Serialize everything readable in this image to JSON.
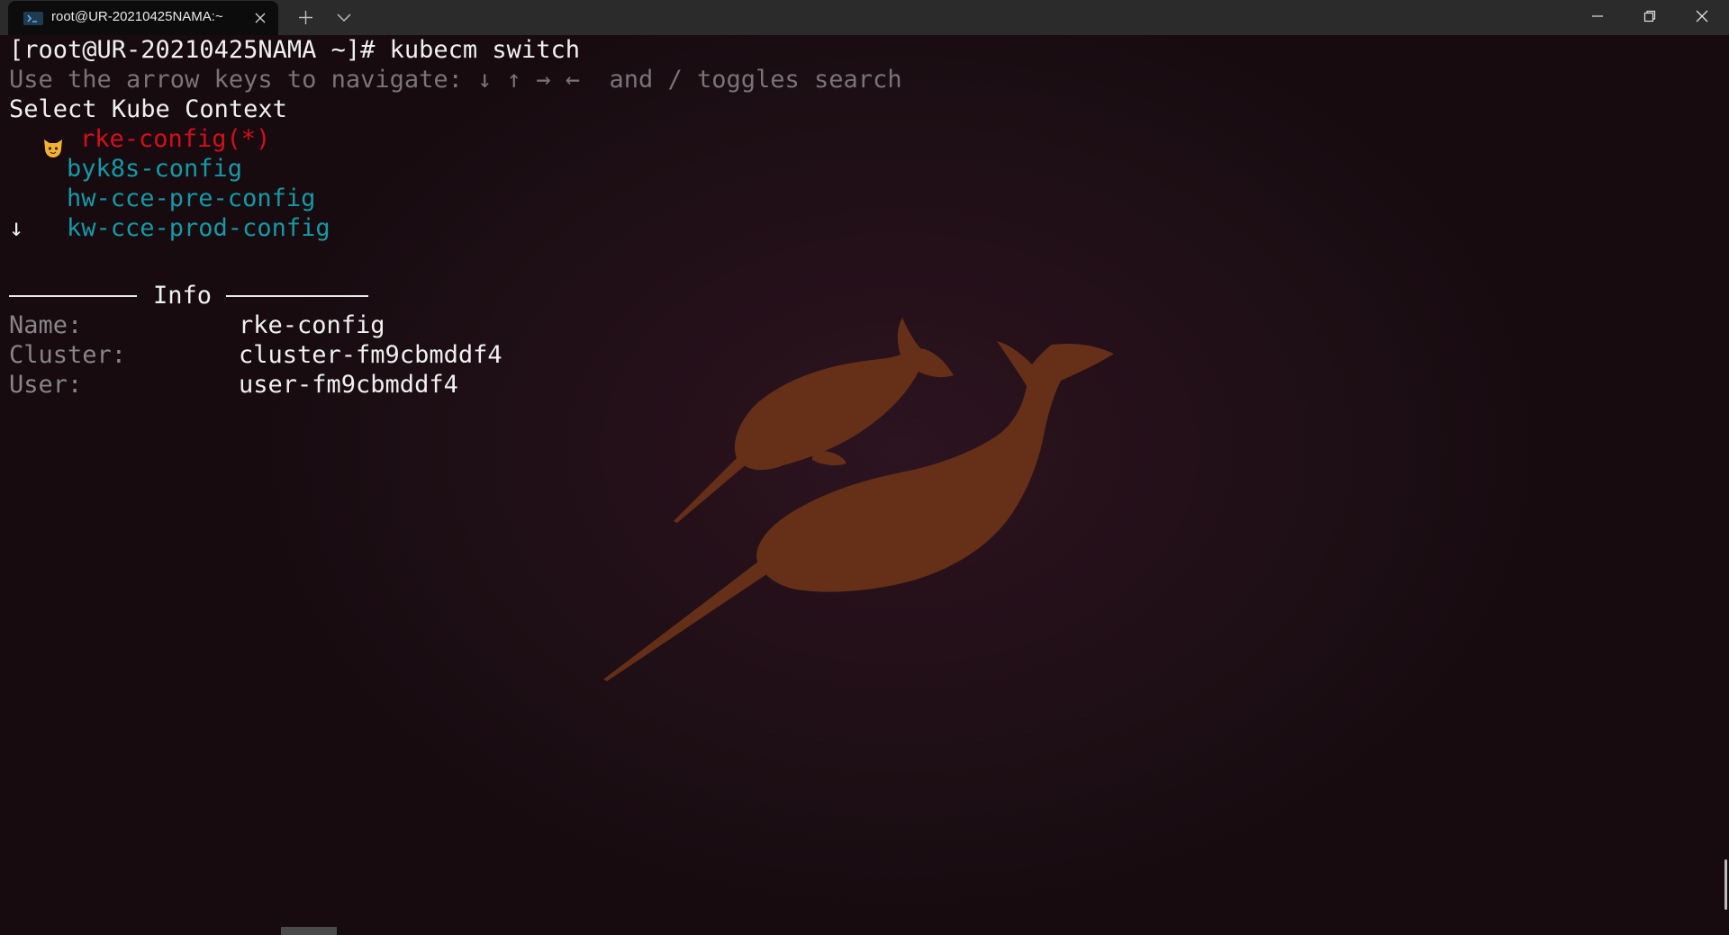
{
  "window": {
    "tab_title": "root@UR-20210425NAMA:~",
    "colors": {
      "titlebar": "#2b2b2b",
      "tab": "#0c0c0c",
      "terminal_bg": "#1e0f16",
      "narwhal": "#6b3218",
      "selected_item": "#d20f1b",
      "item": "#139aa6"
    }
  },
  "icons": {
    "tab_icon": "terminal-icon",
    "tab_close": "close-icon",
    "new_tab": "plus-icon",
    "dropdown": "chevron-down-icon",
    "minimize": "minimize-icon",
    "maximize": "restore-icon",
    "close": "close-icon",
    "selected_marker": "cat-face-emoji-icon",
    "more_below": "arrow-down-icon"
  },
  "terminal": {
    "prompt": "[root@UR-20210425NAMA ~]# kubecm switch",
    "help_line": "Use the arrow keys to navigate: ↓ ↑ → ←  and / toggles search",
    "select_label": "Select Kube Context",
    "contexts": [
      {
        "name": "rke-config(*)",
        "selected": true
      },
      {
        "name": "byk8s-config",
        "selected": false
      },
      {
        "name": "hw-cce-pre-config",
        "selected": false
      },
      {
        "name": "kw-cce-prod-config",
        "selected": false
      }
    ],
    "more_indicator": "↓",
    "info_title": "Info",
    "info": [
      {
        "label": "Name:",
        "value": "rke-config"
      },
      {
        "label": "Cluster:",
        "value": "cluster-fm9cbmddf4"
      },
      {
        "label": "User:",
        "value": "user-fm9cbmddf4"
      }
    ]
  }
}
